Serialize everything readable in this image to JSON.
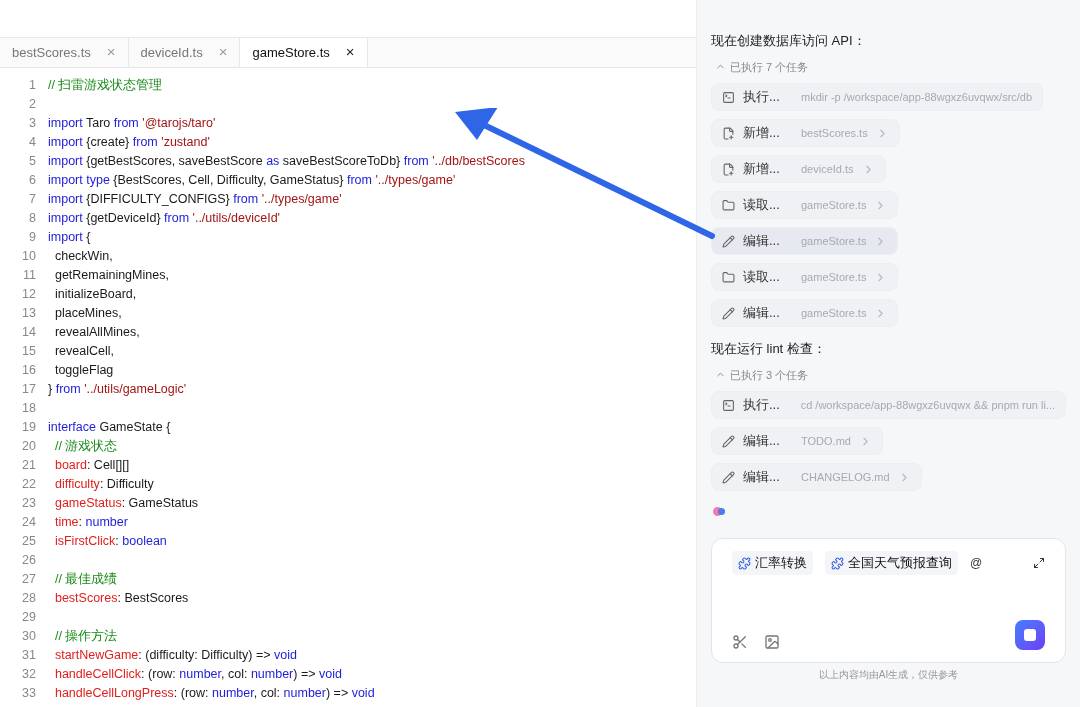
{
  "tabs": [
    {
      "label": "bestScores.ts",
      "close": "×",
      "selected": false
    },
    {
      "label": "deviceId.ts",
      "close": "×",
      "selected": false
    },
    {
      "label": "gameStore.ts",
      "close": "×",
      "selected": true
    }
  ],
  "code": [
    {
      "number": "1",
      "tokens": [
        {
          "kind": "comment",
          "text": "// 扫雷游戏状态管理"
        }
      ]
    },
    {
      "number": "2"
    },
    {
      "number": "3",
      "tokens": [
        {
          "kind": "kw",
          "text": "import"
        },
        {
          "kind": "plain",
          "text": " Taro "
        },
        {
          "kind": "kw",
          "text": "from"
        },
        {
          "kind": "str",
          "text": " '@tarojs/taro'"
        }
      ]
    },
    {
      "number": "4",
      "tokens": [
        {
          "kind": "kw",
          "text": "import"
        },
        {
          "kind": "plain",
          "text": " {create} "
        },
        {
          "kind": "kw",
          "text": "from"
        },
        {
          "kind": "str",
          "text": " 'zustand'"
        }
      ]
    },
    {
      "number": "5",
      "tokens": [
        {
          "kind": "kw",
          "text": "import"
        },
        {
          "kind": "plain",
          "text": " {getBestScores, saveBestScore "
        },
        {
          "kind": "kw",
          "text": "as"
        },
        {
          "kind": "plain",
          "text": " saveBestScoreToDb} "
        },
        {
          "kind": "kw",
          "text": "from"
        },
        {
          "kind": "str",
          "text": " '../db/bestScores"
        }
      ]
    },
    {
      "number": "6",
      "tokens": [
        {
          "kind": "kw",
          "text": "import type"
        },
        {
          "kind": "plain",
          "text": " {BestScores, Cell, Difficulty, GameStatus} "
        },
        {
          "kind": "kw",
          "text": "from"
        },
        {
          "kind": "str",
          "text": " '../types/game'"
        }
      ]
    },
    {
      "number": "7",
      "tokens": [
        {
          "kind": "kw",
          "text": "import"
        },
        {
          "kind": "plain",
          "text": " {DIFFICULTY_CONFIGS} "
        },
        {
          "kind": "kw",
          "text": "from"
        },
        {
          "kind": "str",
          "text": " '../types/game'"
        }
      ]
    },
    {
      "number": "8",
      "tokens": [
        {
          "kind": "kw",
          "text": "import"
        },
        {
          "kind": "plain",
          "text": " {getDeviceId} "
        },
        {
          "kind": "kw",
          "text": "from"
        },
        {
          "kind": "str",
          "text": " '../utils/deviceId'"
        }
      ]
    },
    {
      "number": "9",
      "tokens": [
        {
          "kind": "kw",
          "text": "import"
        },
        {
          "kind": "plain",
          "text": " {"
        }
      ]
    },
    {
      "number": "10",
      "tokens": [
        {
          "kind": "plain",
          "text": "  checkWin,"
        }
      ]
    },
    {
      "number": "11",
      "tokens": [
        {
          "kind": "plain",
          "text": "  getRemainingMines,"
        }
      ]
    },
    {
      "number": "12",
      "tokens": [
        {
          "kind": "plain",
          "text": "  initializeBoard,"
        }
      ]
    },
    {
      "number": "13",
      "tokens": [
        {
          "kind": "plain",
          "text": "  placeMines,"
        }
      ]
    },
    {
      "number": "14",
      "tokens": [
        {
          "kind": "plain",
          "text": "  revealAllMines,"
        }
      ]
    },
    {
      "number": "15",
      "tokens": [
        {
          "kind": "plain",
          "text": "  revealCell,"
        }
      ]
    },
    {
      "number": "16",
      "tokens": [
        {
          "kind": "plain",
          "text": "  toggleFlag"
        }
      ]
    },
    {
      "number": "17",
      "tokens": [
        {
          "kind": "plain",
          "text": "} "
        },
        {
          "kind": "kw",
          "text": "from"
        },
        {
          "kind": "str",
          "text": " '../utils/gameLogic'"
        }
      ]
    },
    {
      "number": "18"
    },
    {
      "number": "19",
      "tokens": [
        {
          "kind": "kw",
          "text": "interface"
        },
        {
          "kind": "plain",
          "text": " GameState {"
        }
      ]
    },
    {
      "number": "20",
      "tokens": [
        {
          "kind": "comment",
          "text": "  // 游戏状态"
        }
      ]
    },
    {
      "number": "21",
      "tokens": [
        {
          "kind": "prop",
          "text": "  board"
        },
        {
          "kind": "plain",
          "text": ": Cell[][]"
        }
      ]
    },
    {
      "number": "22",
      "tokens": [
        {
          "kind": "prop",
          "text": "  difficulty"
        },
        {
          "kind": "plain",
          "text": ": Difficulty"
        }
      ]
    },
    {
      "number": "23",
      "tokens": [
        {
          "kind": "prop",
          "text": "  gameStatus"
        },
        {
          "kind": "plain",
          "text": ": GameStatus"
        }
      ]
    },
    {
      "number": "24",
      "tokens": [
        {
          "kind": "prop",
          "text": "  time"
        },
        {
          "kind": "plain",
          "text": ": "
        },
        {
          "kind": "kw",
          "text": "number"
        }
      ]
    },
    {
      "number": "25",
      "tokens": [
        {
          "kind": "prop",
          "text": "  isFirstClick"
        },
        {
          "kind": "plain",
          "text": ": "
        },
        {
          "kind": "kw",
          "text": "boolean"
        }
      ]
    },
    {
      "number": "26"
    },
    {
      "number": "27",
      "tokens": [
        {
          "kind": "comment",
          "text": "  // 最佳成绩"
        }
      ]
    },
    {
      "number": "28",
      "tokens": [
        {
          "kind": "prop",
          "text": "  bestScores"
        },
        {
          "kind": "plain",
          "text": ": BestScores"
        }
      ]
    },
    {
      "number": "29"
    },
    {
      "number": "30",
      "tokens": [
        {
          "kind": "comment",
          "text": "  // 操作方法"
        }
      ]
    },
    {
      "number": "31",
      "tokens": [
        {
          "kind": "prop",
          "text": "  startNewGame"
        },
        {
          "kind": "plain",
          "text": ": (difficulty: Difficulty) => "
        },
        {
          "kind": "kw",
          "text": "void"
        }
      ]
    },
    {
      "number": "32",
      "tokens": [
        {
          "kind": "prop",
          "text": "  handleCellClick"
        },
        {
          "kind": "plain",
          "text": ": (row: "
        },
        {
          "kind": "kw",
          "text": "number"
        },
        {
          "kind": "plain",
          "text": ", col: "
        },
        {
          "kind": "kw",
          "text": "number"
        },
        {
          "kind": "plain",
          "text": ") => "
        },
        {
          "kind": "kw",
          "text": "void"
        }
      ]
    },
    {
      "number": "33",
      "tokens": [
        {
          "kind": "prop",
          "text": "  handleCellLongPress"
        },
        {
          "kind": "plain",
          "text": ": (row: "
        },
        {
          "kind": "kw",
          "text": "number"
        },
        {
          "kind": "plain",
          "text": ", col: "
        },
        {
          "kind": "kw",
          "text": "number"
        },
        {
          "kind": "plain",
          "text": ") => "
        },
        {
          "kind": "kw",
          "text": "void"
        }
      ]
    }
  ],
  "chat": {
    "sections": [
      {
        "message": "现在创建数据库访问 API：",
        "summary": "已执行 7 个任务",
        "expanded": true,
        "tasks": [
          {
            "kind": "terminal",
            "action": "执行...",
            "detail": "mkdir -p /workspace/app-88wgxz6uvqwx/src/db",
            "selected": false
          },
          {
            "kind": "file-add",
            "action": "新增...",
            "detail": "bestScores.ts",
            "selected": false
          },
          {
            "kind": "file-add",
            "action": "新增...",
            "detail": "deviceId.ts",
            "selected": false
          },
          {
            "kind": "read",
            "action": "读取...",
            "detail": "gameStore.ts",
            "selected": false
          },
          {
            "kind": "edit",
            "action": "编辑...",
            "detail": "gameStore.ts",
            "selected": true
          },
          {
            "kind": "read",
            "action": "读取...",
            "detail": "gameStore.ts",
            "selected": false
          },
          {
            "kind": "edit",
            "action": "编辑...",
            "detail": "gameStore.ts",
            "selected": false
          }
        ]
      },
      {
        "message": "现在运行 lint 检查：",
        "summary": "已执行 3 个任务",
        "expanded": true,
        "tasks": [
          {
            "kind": "terminal",
            "action": "执行...",
            "detail": "cd /workspace/app-88wgxz6uvqwx && pnpm run li...",
            "selected": false
          },
          {
            "kind": "edit",
            "action": "编辑...",
            "detail": "TODO.md",
            "selected": false
          },
          {
            "kind": "edit",
            "action": "编辑...",
            "detail": "CHANGELOG.md",
            "selected": false
          }
        ]
      }
    ],
    "composer": {
      "chips": [
        "汇率转换",
        "全国天气预报查询"
      ],
      "mention": "@"
    },
    "disclaimer": "以上内容均由AI生成，仅供参考"
  }
}
